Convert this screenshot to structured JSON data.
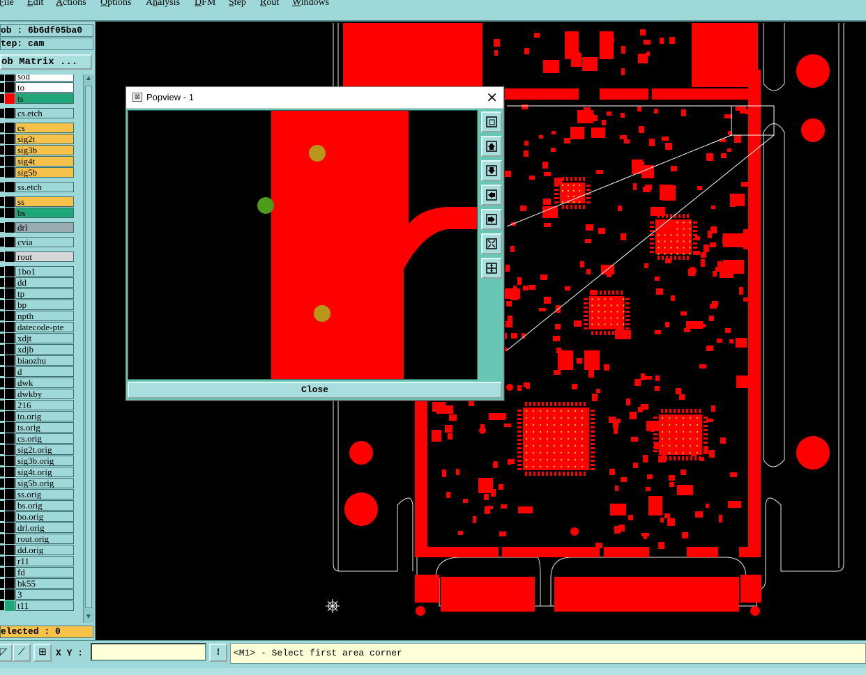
{
  "menubar": {
    "items": [
      {
        "label": "File",
        "accel": "F"
      },
      {
        "label": "Edit",
        "accel": "E"
      },
      {
        "label": "Actions",
        "accel": "A"
      },
      {
        "label": "Options",
        "accel": "O"
      },
      {
        "label": "Analysis",
        "accel": "n"
      },
      {
        "label": "DFM",
        "accel": "D"
      },
      {
        "label": "Step",
        "accel": "S"
      },
      {
        "label": "Rout",
        "accel": "R"
      },
      {
        "label": "Windows",
        "accel": "W"
      }
    ]
  },
  "left_panel": {
    "job": "ob : 6b6df05ba0",
    "step": "tep: cam",
    "job_matrix_button": "ob Matrix ...",
    "selected": "elected : 0",
    "layers": [
      {
        "name": "sod",
        "swatch": "#000000",
        "bg": "#ffffff"
      },
      {
        "name": "to",
        "swatch": "#000000",
        "bg": "#ffffff"
      },
      {
        "name": "ts",
        "swatch": "#ff0000",
        "bg": "#1fa77a"
      },
      {
        "name": "cs.etch",
        "swatch": "#000000",
        "bg": "#9fd8d8"
      },
      {
        "name": "cs",
        "swatch": "#000000",
        "bg": "#f7c24a"
      },
      {
        "name": "sig2t",
        "swatch": "#000000",
        "bg": "#f7c24a"
      },
      {
        "name": "sig3b",
        "swatch": "#000000",
        "bg": "#f7c24a"
      },
      {
        "name": "sig4t",
        "swatch": "#000000",
        "bg": "#f7c24a"
      },
      {
        "name": "sig5b",
        "swatch": "#000000",
        "bg": "#f7c24a"
      },
      {
        "name": "ss.etch",
        "swatch": "#000000",
        "bg": "#9fd8d8"
      },
      {
        "name": "ss",
        "swatch": "#000000",
        "bg": "#f7c24a"
      },
      {
        "name": "bs",
        "swatch": "#000000",
        "bg": "#1fa77a"
      },
      {
        "name": "drl",
        "swatch": "#000000",
        "bg": "#9aabb2"
      },
      {
        "name": "cvia",
        "swatch": "#000000",
        "bg": "#9fd8d8"
      },
      {
        "name": "rout",
        "swatch": "#000000",
        "bg": "#d6d6d6"
      },
      {
        "name": "1bo1",
        "swatch": "#000000",
        "bg": "#9fd8d8"
      },
      {
        "name": "dd",
        "swatch": "#000000",
        "bg": "#9fd8d8"
      },
      {
        "name": "tp",
        "swatch": "#000000",
        "bg": "#9fd8d8"
      },
      {
        "name": "bp",
        "swatch": "#000000",
        "bg": "#9fd8d8"
      },
      {
        "name": "npth",
        "swatch": "#000000",
        "bg": "#9fd8d8"
      },
      {
        "name": "datecode-pte",
        "swatch": "#000000",
        "bg": "#9fd8d8"
      },
      {
        "name": "xdjt",
        "swatch": "#000000",
        "bg": "#9fd8d8"
      },
      {
        "name": "xdjb",
        "swatch": "#000000",
        "bg": "#9fd8d8"
      },
      {
        "name": "biaozhu",
        "swatch": "#000000",
        "bg": "#9fd8d8"
      },
      {
        "name": "d",
        "swatch": "#000000",
        "bg": "#9fd8d8"
      },
      {
        "name": "dwk",
        "swatch": "#000000",
        "bg": "#9fd8d8"
      },
      {
        "name": "dwkby",
        "swatch": "#000000",
        "bg": "#9fd8d8"
      },
      {
        "name": "216",
        "swatch": "#000000",
        "bg": "#9fd8d8"
      },
      {
        "name": "to.orig",
        "swatch": "#000000",
        "bg": "#9fd8d8"
      },
      {
        "name": "ts.orig",
        "swatch": "#000000",
        "bg": "#9fd8d8"
      },
      {
        "name": "cs.orig",
        "swatch": "#000000",
        "bg": "#9fd8d8"
      },
      {
        "name": "sig2t.orig",
        "swatch": "#000000",
        "bg": "#9fd8d8"
      },
      {
        "name": "sig3b.orig",
        "swatch": "#000000",
        "bg": "#9fd8d8"
      },
      {
        "name": "sig4t.orig",
        "swatch": "#000000",
        "bg": "#9fd8d8"
      },
      {
        "name": "sig5b.orig",
        "swatch": "#000000",
        "bg": "#9fd8d8"
      },
      {
        "name": "ss.orig",
        "swatch": "#000000",
        "bg": "#9fd8d8"
      },
      {
        "name": "bs.orig",
        "swatch": "#000000",
        "bg": "#9fd8d8"
      },
      {
        "name": "bo.orig",
        "swatch": "#000000",
        "bg": "#9fd8d8"
      },
      {
        "name": "drl.orig",
        "swatch": "#000000",
        "bg": "#9fd8d8"
      },
      {
        "name": "rout.orig",
        "swatch": "#000000",
        "bg": "#9fd8d8"
      },
      {
        "name": "dd.orig",
        "swatch": "#000000",
        "bg": "#9fd8d8"
      },
      {
        "name": "r11",
        "swatch": "#000000",
        "bg": "#9fd8d8"
      },
      {
        "name": "fd",
        "swatch": "#000000",
        "bg": "#9fd8d8"
      },
      {
        "name": "bk55",
        "swatch": "#000000",
        "bg": "#9fd8d8"
      },
      {
        "name": "3",
        "swatch": "#000000",
        "bg": "#9fd8d8"
      },
      {
        "name": "t11",
        "swatch": "#1fa77a",
        "bg": "#9fd8d8"
      }
    ]
  },
  "bottom": {
    "xy_label": "X Y :",
    "xy_value": "",
    "status": "<M1> - Select first area corner",
    "alert_glyph": "!"
  },
  "popview": {
    "title": "Popview - 1",
    "close_glyph": "✕",
    "close_button": "Close",
    "tools": [
      "zoom-fit-icon",
      "pan-up-icon",
      "pan-down-icon",
      "pan-left-icon",
      "pan-right-icon",
      "zoom-in-icon",
      "zoom-out-icon"
    ]
  },
  "colors": {
    "copper": "#ff0000",
    "pad_gold": "#f0c020",
    "ui_teal": "#9fd8d8",
    "highlight_orange": "#f7c24a",
    "highlight_green": "#1fa77a"
  }
}
